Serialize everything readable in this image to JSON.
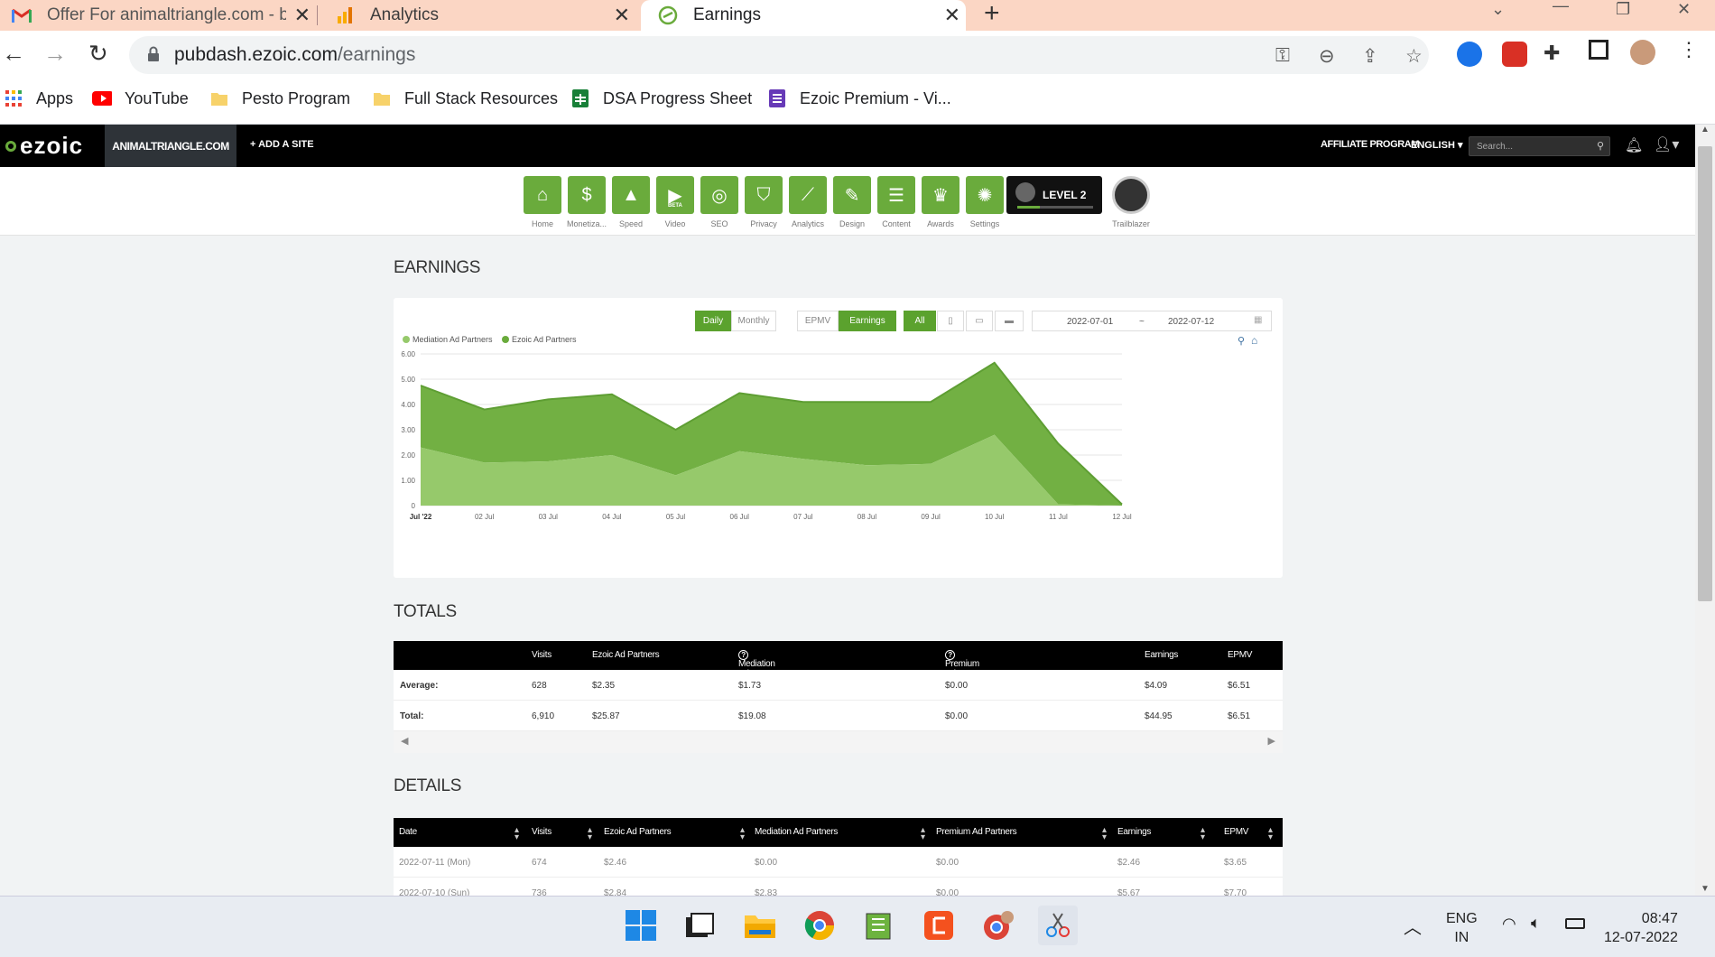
{
  "browser": {
    "tabs": [
      {
        "title": "Offer For animaltriangle.com - ba",
        "icon": "gmail-icon"
      },
      {
        "title": "Analytics",
        "icon": "analytics-icon"
      },
      {
        "title": "Earnings",
        "icon": "ezoic-icon",
        "active": true
      }
    ],
    "close_glyph": "✕",
    "new_tab_glyph": "+",
    "url_host": "pubdash.ezoic.com",
    "url_path": "/earnings",
    "bookmarks": [
      {
        "label": "Apps",
        "icon": "apps-grid-icon"
      },
      {
        "label": "YouTube",
        "icon": "youtube-icon"
      },
      {
        "label": "Pesto Program",
        "icon": "folder-icon"
      },
      {
        "label": "Full Stack Resources",
        "icon": "folder-icon"
      },
      {
        "label": "DSA Progress Sheet",
        "icon": "sheets-icon"
      },
      {
        "label": "Ezoic Premium - Vi...",
        "icon": "forms-icon"
      }
    ]
  },
  "ezoic": {
    "logo": "ezoic",
    "site": "ANIMALTRIANGLE.COM",
    "add_site": "+ ADD A SITE",
    "affiliate": "AFFILIATE PROGRAM",
    "language": "ENGLISH",
    "search_placeholder": "Search...",
    "nav": [
      {
        "label": "Home",
        "glyph": "⌂"
      },
      {
        "label": "Monetiza...",
        "glyph": "$"
      },
      {
        "label": "Speed",
        "glyph": "▲"
      },
      {
        "label": "Video",
        "glyph": "▶"
      },
      {
        "label": "SEO",
        "glyph": "◎"
      },
      {
        "label": "Privacy",
        "glyph": "⛉"
      },
      {
        "label": "Analytics",
        "glyph": "⟋"
      },
      {
        "label": "Design",
        "glyph": "✎"
      },
      {
        "label": "Content",
        "glyph": "☰"
      },
      {
        "label": "Awards",
        "glyph": "♛"
      },
      {
        "label": "Settings",
        "glyph": "✺"
      }
    ],
    "video_badge": "BETA",
    "level": "LEVEL 2",
    "level_progress": 0.3,
    "trailblazer": "Trailblazer"
  },
  "earnings": {
    "section_title": "EARNINGS",
    "toggles": {
      "daily": "Daily",
      "monthly": "Monthly",
      "epmv": "EPMV",
      "earnings": "Earnings",
      "all": "All"
    },
    "date_from": "2022-07-01",
    "date_sep": "~",
    "date_to": "2022-07-12"
  },
  "chart_data": {
    "type": "area",
    "stacked": true,
    "categories": [
      "Jul '22",
      "02 Jul",
      "03 Jul",
      "04 Jul",
      "05 Jul",
      "06 Jul",
      "07 Jul",
      "08 Jul",
      "09 Jul",
      "10 Jul",
      "11 Jul",
      "12 Jul"
    ],
    "series": [
      {
        "name": "Mediation Ad Partners",
        "color": "#96c96b",
        "values": [
          2.3,
          1.7,
          1.75,
          2.0,
          1.2,
          2.15,
          1.85,
          1.6,
          1.65,
          2.8,
          0.05,
          0.0
        ]
      },
      {
        "name": "Ezoic Ad Partners",
        "color": "#72b043",
        "values": [
          2.45,
          2.1,
          2.45,
          2.4,
          1.8,
          2.3,
          2.25,
          2.5,
          2.45,
          2.85,
          2.4,
          0.05
        ]
      }
    ],
    "yticks": [
      "0",
      "1.00",
      "2.00",
      "3.00",
      "4.00",
      "5.00",
      "6.00"
    ],
    "ylim": [
      0,
      6
    ],
    "grid": true,
    "legend_position": "top-left"
  },
  "totals": {
    "section_title": "TOTALS",
    "headers": [
      "Visits",
      "Ezoic Ad Partners",
      "Mediation Ad Partners",
      "Premium Ad Partners",
      "Earnings",
      "EPMV"
    ],
    "rows": [
      {
        "label": "Average:",
        "cells": [
          "628",
          "$2.35",
          "$1.73",
          "$0.00",
          "$4.09",
          "$6.51"
        ]
      },
      {
        "label": "Total:",
        "cells": [
          "6,910",
          "$25.87",
          "$19.08",
          "$0.00",
          "$44.95",
          "$6.51"
        ]
      }
    ]
  },
  "details": {
    "section_title": "DETAILS",
    "headers": [
      "Date",
      "Visits",
      "Ezoic Ad Partners",
      "Mediation Ad Partners",
      "Premium Ad Partners",
      "Earnings",
      "EPMV"
    ],
    "rows": [
      [
        "2022-07-11 (Mon)",
        "674",
        "$2.46",
        "$0.00",
        "$0.00",
        "$2.46",
        "$3.65"
      ],
      [
        "2022-07-10 (Sun)",
        "736",
        "$2.84",
        "$2.83",
        "$0.00",
        "$5.67",
        "$7.70"
      ]
    ]
  },
  "taskbar": {
    "lang_top": "ENG",
    "lang_bottom": "IN",
    "time": "08:47",
    "date": "12-07-2022"
  }
}
